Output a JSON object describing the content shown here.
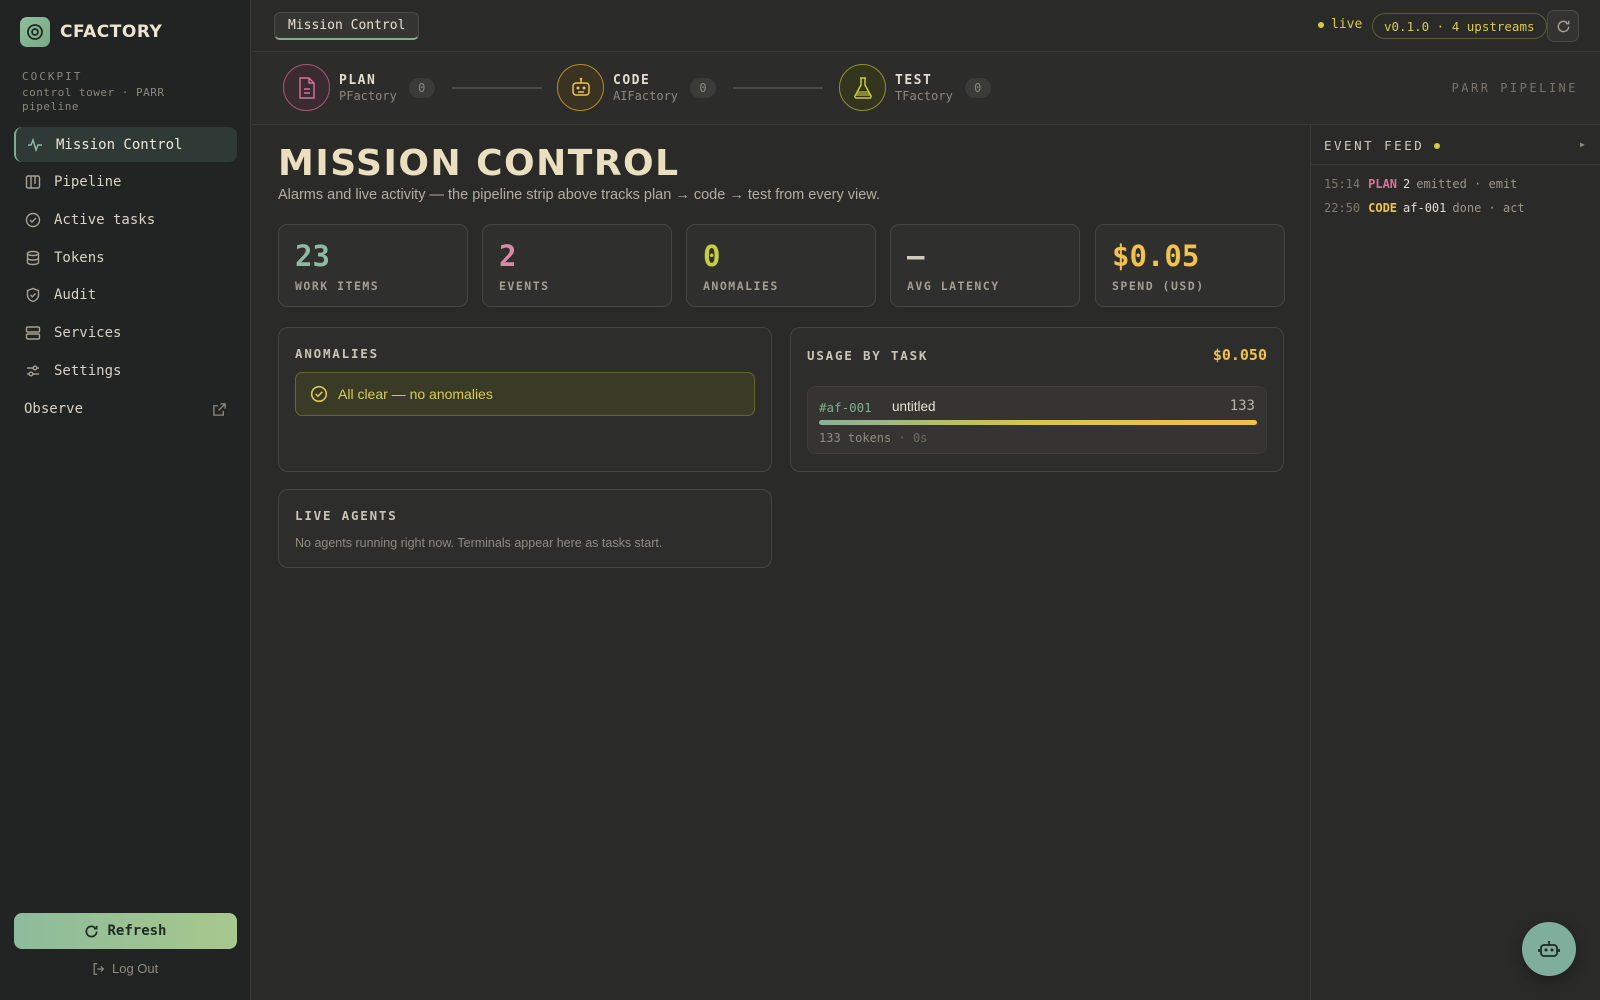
{
  "brand": {
    "name": "CFACTORY"
  },
  "cockpit": {
    "title": "COCKPIT",
    "subtitle": "control tower · PARR pipeline"
  },
  "nav": {
    "items": [
      {
        "label": "Mission Control",
        "icon": "activity-icon",
        "active": true
      },
      {
        "label": "Pipeline",
        "icon": "kanban-icon"
      },
      {
        "label": "Active tasks",
        "icon": "check-circle-icon"
      },
      {
        "label": "Tokens",
        "icon": "database-icon"
      },
      {
        "label": "Audit",
        "icon": "shield-check-icon"
      },
      {
        "label": "Services",
        "icon": "server-icon"
      },
      {
        "label": "Settings",
        "icon": "sliders-icon"
      }
    ],
    "observe": "Observe"
  },
  "sidebar_footer": {
    "refresh": "Refresh",
    "logout": "Log Out"
  },
  "topbar": {
    "breadcrumb": "Mission Control",
    "live": "live",
    "version": "v0.1.0 · 4 upstreams"
  },
  "pipeline": {
    "stages": [
      {
        "name": "PLAN",
        "sub": "PFactory",
        "count": "0",
        "color": "#d9739b",
        "icon": "document-icon"
      },
      {
        "name": "CODE",
        "sub": "AIFactory",
        "count": "0",
        "color": "#f2c14e",
        "icon": "robot-icon"
      },
      {
        "name": "TEST",
        "sub": "TFactory",
        "count": "0",
        "color": "#c8cc3e",
        "icon": "flask-icon"
      }
    ],
    "label": "PARR PIPELINE"
  },
  "page": {
    "title": "MISSION CONTROL",
    "subtitle": "Alarms and live activity — the pipeline strip above tracks plan → code → test from every view."
  },
  "stats": [
    {
      "value": "23",
      "label": "WORK ITEMS",
      "color": "#8fb9a3"
    },
    {
      "value": "2",
      "label": "EVENTS",
      "color": "#d98aa8"
    },
    {
      "value": "0",
      "label": "ANOMALIES",
      "color": "#c8cc3e"
    },
    {
      "value": "—",
      "label": "AVG LATENCY",
      "color": "#d0cbbd"
    },
    {
      "value": "$0.05",
      "label": "SPEND (USD)",
      "color": "#f2c14e"
    }
  ],
  "anomalies": {
    "title": "ANOMALIES",
    "message": "All clear — no anomalies"
  },
  "usage": {
    "title": "USAGE BY TASK",
    "total": "$0.050",
    "tasks": [
      {
        "id": "#af-001",
        "name": "untitled",
        "count": "133",
        "tokens": "133 tokens",
        "duration": "0s",
        "fraction": 1.0
      }
    ]
  },
  "agents": {
    "title": "LIVE AGENTS",
    "empty": "No agents running right now. Terminals appear here as tasks start."
  },
  "feed": {
    "title": "EVENT FEED",
    "toggle": "▸",
    "events": [
      {
        "time": "15:14",
        "kind": "PLAN",
        "kind_color": "#d9739b",
        "subject": "2",
        "text": "emitted · emit"
      },
      {
        "time": "22:50",
        "kind": "CODE",
        "kind_color": "#f2c14e",
        "subject": "af-001",
        "text": "done · act"
      }
    ]
  },
  "colors": {
    "accent": "#7fae90",
    "warn": "#f2c14e",
    "background": "#2a2a29"
  }
}
